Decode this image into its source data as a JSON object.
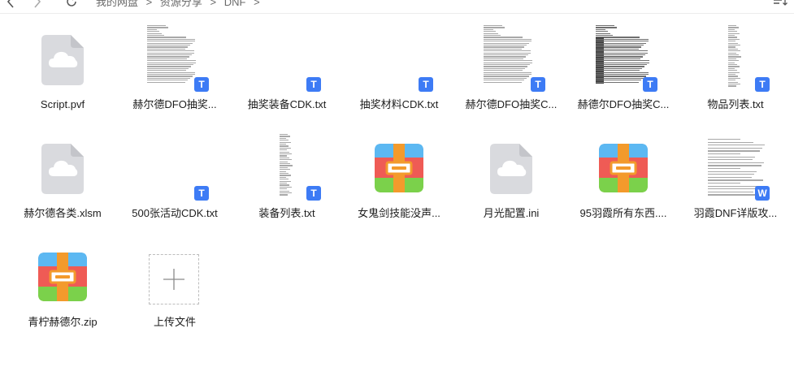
{
  "topbar": {
    "breadcrumb": [
      "我的网盘",
      ">",
      "资源分享",
      ">",
      "DNF",
      ">"
    ]
  },
  "files": [
    {
      "name": "Script.pvf",
      "icon": "cloud-file-icon",
      "kind": "cloud"
    },
    {
      "name": "赫尔德DFO抽奖...",
      "icon": "text-file-icon",
      "kind": "text",
      "badge": "T"
    },
    {
      "name": "抽奖装备CDK.txt",
      "icon": "text-file-icon",
      "kind": "blank",
      "badge": "T"
    },
    {
      "name": "抽奖材料CDK.txt",
      "icon": "text-file-icon",
      "kind": "blank",
      "badge": "T"
    },
    {
      "name": "赫尔德DFO抽奖C...",
      "icon": "text-file-icon",
      "kind": "text",
      "badge": "T"
    },
    {
      "name": "赫德尔DFO抽奖C...",
      "icon": "text-file-icon",
      "kind": "dense",
      "badge": "T"
    },
    {
      "name": "物品列表.txt",
      "icon": "text-file-icon",
      "kind": "narrow",
      "badge": "T"
    },
    {
      "name": "赫尔德各类.xlsm",
      "icon": "cloud-file-icon",
      "kind": "cloud"
    },
    {
      "name": "500张活动CDK.txt",
      "icon": "text-file-icon",
      "kind": "blank",
      "badge": "T"
    },
    {
      "name": "装备列表.txt",
      "icon": "text-file-icon",
      "kind": "narrow",
      "badge": "T"
    },
    {
      "name": "女鬼剑技能没声...",
      "icon": "zip-icon",
      "kind": "zip"
    },
    {
      "name": "月光配置.ini",
      "icon": "cloud-file-icon",
      "kind": "cloud"
    },
    {
      "name": "95羽霞所有东西....",
      "icon": "zip-icon",
      "kind": "zip"
    },
    {
      "name": "羽霞DNF详版攻...",
      "icon": "word-file-icon",
      "kind": "doc",
      "badge": "W"
    },
    {
      "name": "青柠赫德尔.zip",
      "icon": "zip-icon",
      "kind": "zip"
    },
    {
      "name": "上传文件",
      "icon": "plus-icon",
      "kind": "upload"
    }
  ],
  "colors": {
    "badge_text": "#3d7bf5",
    "badge_word": "#3d7bf5",
    "cloud_bg": "#d9dade",
    "zip_top": "#5cb8f2",
    "zip_mid": "#ef5b55",
    "zip_bottom": "#7bd14b",
    "zip_strap": "#f39a2c"
  }
}
